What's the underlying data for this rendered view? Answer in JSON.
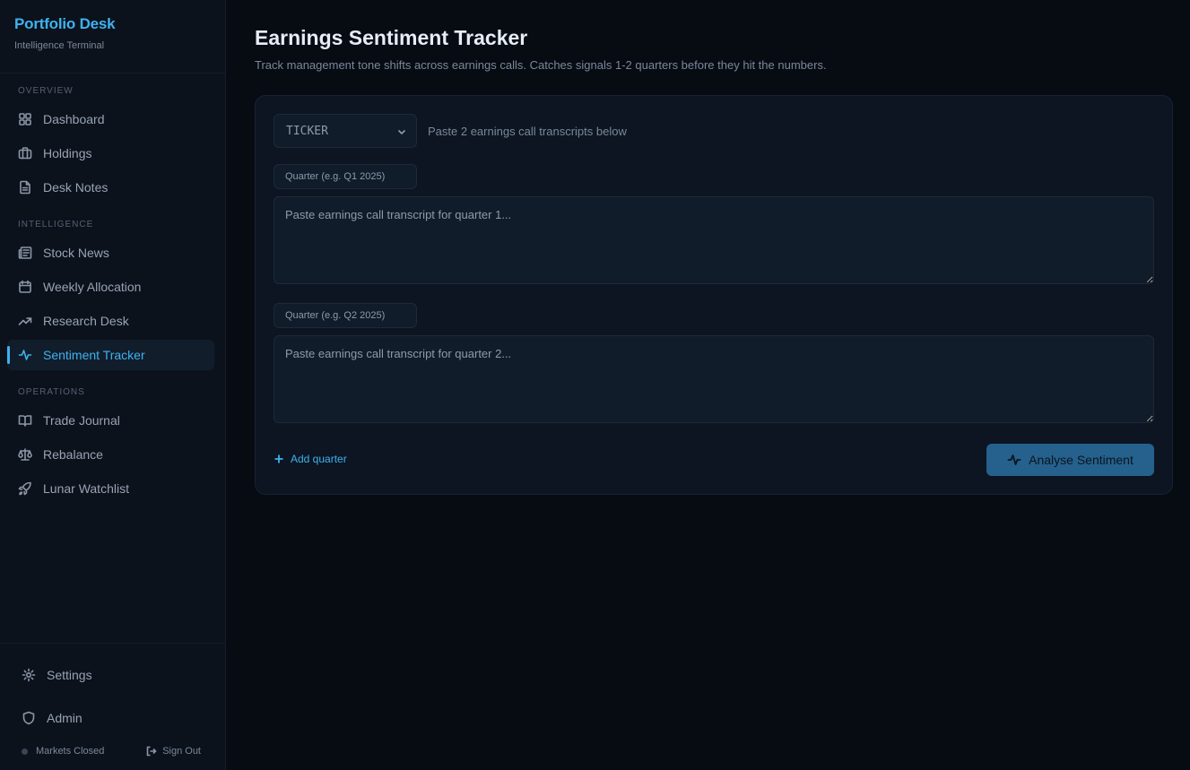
{
  "brand": {
    "title": "Portfolio Desk",
    "subtitle": "Intelligence Terminal"
  },
  "sidebar": {
    "sections": [
      {
        "label": "OVERVIEW"
      },
      {
        "label": "INTELLIGENCE"
      },
      {
        "label": "OPERATIONS"
      }
    ],
    "items": [
      {
        "label": "Dashboard",
        "icon": "grid-icon"
      },
      {
        "label": "Holdings",
        "icon": "briefcase-icon"
      },
      {
        "label": "Desk Notes",
        "icon": "document-icon"
      },
      {
        "label": "Stock News",
        "icon": "newspaper-icon"
      },
      {
        "label": "Weekly Allocation",
        "icon": "calendar-icon"
      },
      {
        "label": "Research Desk",
        "icon": "trending-up-icon"
      },
      {
        "label": "Sentiment Tracker",
        "icon": "activity-icon",
        "active": true
      },
      {
        "label": "Trade Journal",
        "icon": "book-icon"
      },
      {
        "label": "Rebalance",
        "icon": "scale-icon"
      },
      {
        "label": "Lunar Watchlist",
        "icon": "rocket-icon"
      }
    ],
    "footer": {
      "settings": "Settings",
      "admin": "Admin",
      "market_status": "Markets Closed",
      "sign_out": "Sign Out"
    }
  },
  "main": {
    "title": "Earnings Sentiment Tracker",
    "description": "Track management tone shifts across earnings calls. Catches signals 1-2 quarters before they hit the numbers.",
    "ticker": {
      "value": "TICKER"
    },
    "hint": "Paste 2 earnings call transcripts below",
    "quarters": [
      {
        "quarter_placeholder": "Quarter (e.g. Q1 2025)",
        "transcript_placeholder": "Paste earnings call transcript for quarter 1..."
      },
      {
        "quarter_placeholder": "Quarter (e.g. Q2 2025)",
        "transcript_placeholder": "Paste earnings call transcript for quarter 2..."
      }
    ],
    "add_quarter": "Add quarter",
    "analyse_button": "Analyse Sentiment"
  },
  "colors": {
    "accent": "#3fb2ef",
    "button": "#25618c",
    "background": "#070b12"
  }
}
